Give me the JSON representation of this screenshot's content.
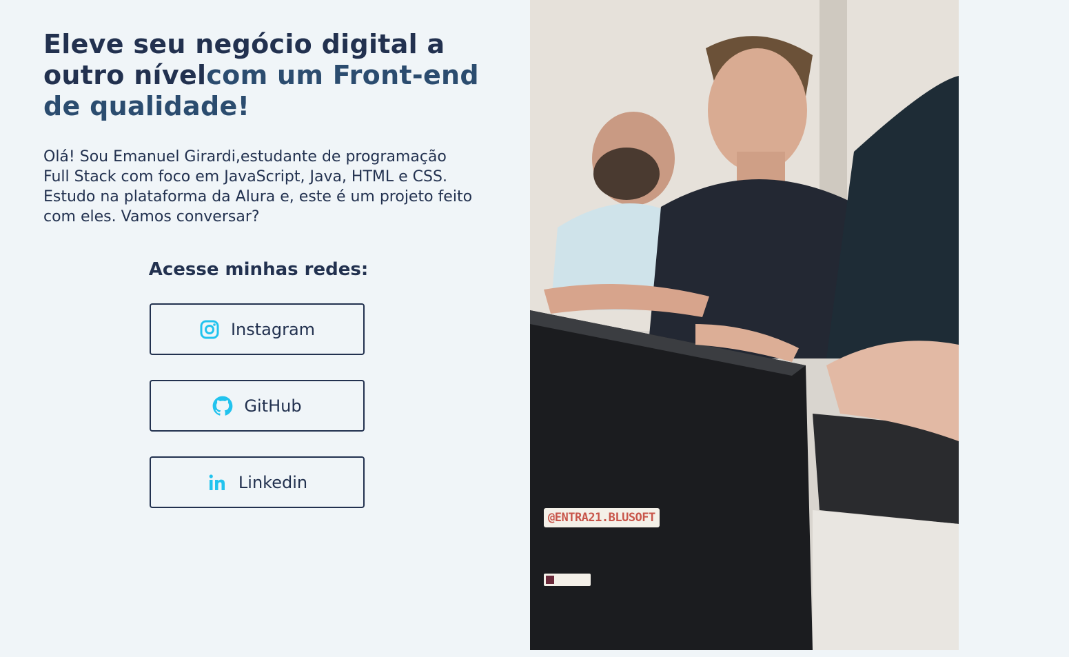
{
  "hero": {
    "headline_part1": "Eleve seu negócio digital a outro nível",
    "headline_part2": "com um Front-end de qualidade!",
    "intro": "Olá! Sou Emanuel Girardi,estudante de programação Full Stack com foco em JavaScript, Java, HTML e CSS. Estudo na plataforma da Alura e, este é um projeto feito com eles. Vamos conversar?"
  },
  "social": {
    "title": "Acesse minhas redes:",
    "links": [
      {
        "label": "Instagram",
        "icon": "instagram-icon"
      },
      {
        "label": "GitHub",
        "icon": "github-icon"
      },
      {
        "label": "Linkedin",
        "icon": "linkedin-icon"
      }
    ]
  },
  "photo": {
    "sticker_text": "@ENTRA21.BLUSOFT"
  },
  "colors": {
    "background": "#f0f5f8",
    "text": "#22314f",
    "icon_accent": "#22c3ee"
  }
}
